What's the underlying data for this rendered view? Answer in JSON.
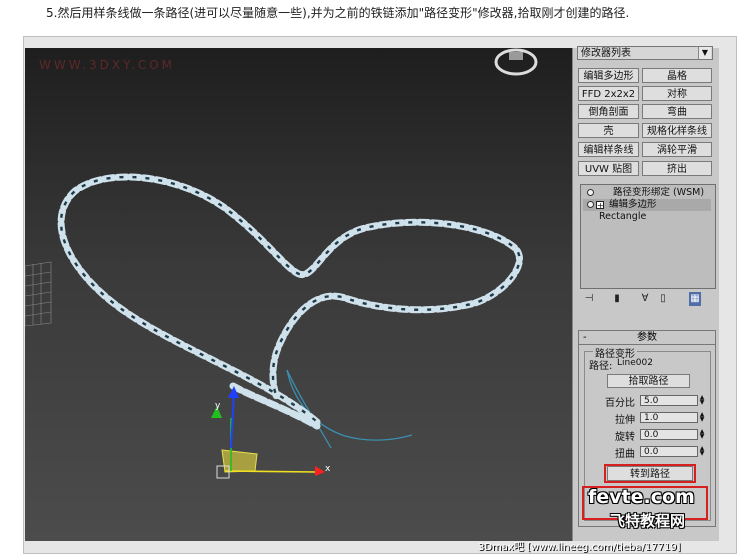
{
  "caption": "5.然后用样条线做一条路径(进可以尽量随意一些),并为之前的铁链添加\"路径变形\"修改器,拾取刚才创建的路径.",
  "viewport": {
    "watermark": "WWW.3DXY.COM",
    "axis_x_label": "x",
    "axis_y_label": "y",
    "colors": {
      "chain": "#e6eef3",
      "spline": "#3a8fb0",
      "axis_x": "#ff2020",
      "axis_y": "#20c020",
      "axis_z": "#2040ff"
    }
  },
  "panel": {
    "modifier_list": "修改器列表",
    "buttons": [
      "编辑多边形",
      "晶格",
      "FFD 2x2x2",
      "对称",
      "倒角剖面",
      "弯曲",
      "壳",
      "规格化样条线",
      "编辑样条线",
      "涡轮平滑",
      "UVW 贴图",
      "挤出"
    ],
    "stack": [
      "路径变形绑定 (WSM)",
      "编辑多边形",
      "Rectangle"
    ],
    "rollout_title": "参数",
    "group_title": "路径变形",
    "path_label": "路径:",
    "path_value": "Line002",
    "pick_path": "拾取路径",
    "params": [
      {
        "label": "百分比",
        "value": "5.0"
      },
      {
        "label": "拉伸",
        "value": "1.0"
      },
      {
        "label": "旋转",
        "value": "0.0"
      },
      {
        "label": "扭曲",
        "value": "0.0"
      }
    ],
    "move_to_path": "转到路径"
  },
  "logo": {
    "line1": "fevte.com",
    "line2": "飞特教程网"
  },
  "footer": "3Dmax吧 [www.lineeg.com/tieba/17719]"
}
